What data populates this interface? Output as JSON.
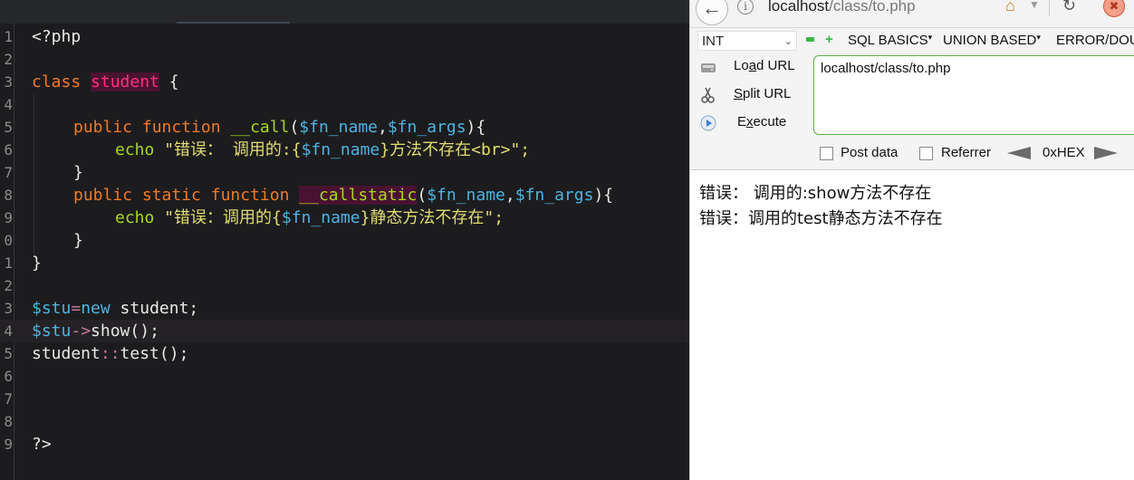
{
  "editor": {
    "line_numbers": [
      "1",
      "2",
      "3",
      "4",
      "5",
      "6",
      "7",
      "8",
      "9",
      "0",
      "1",
      "2",
      "3",
      "4",
      "5",
      "6",
      "7",
      "8",
      "9"
    ],
    "tokens": {
      "php_open": "<?php",
      "kw_class": "class",
      "class_name": "student",
      "brace_open": " {",
      "kw_public": "public",
      "kw_function": "function",
      "call_name": "__call",
      "paren_open": "(",
      "var_fn_name": "$fn_name",
      "comma": ",",
      "var_fn_args": "$fn_args",
      "paren_close_brace": "){",
      "kw_echo": "echo",
      "str1_a": "\"错误： 调用的:{",
      "str1_b": "}方法不存在",
      "str1_br": "<br>",
      "str1_end": "\";",
      "close_brace": "}",
      "kw_static": "static",
      "callstatic_name": "__callstatic",
      "str2_a": "\"错误：调用的{",
      "str2_b": "}静态方法不存在\";",
      "var_stu": "$stu",
      "op_assign": "=",
      "kw_new": "new",
      "new_rest": " student;",
      "op_arrow": "->",
      "show_call": "show();",
      "student_ref": "student",
      "op_scope": "::",
      "test_call": "test();",
      "php_close": "?>"
    }
  },
  "browser": {
    "url_bar": {
      "host": "localhost",
      "path": "/class/to.php"
    },
    "hackbar": {
      "int_select": "INT",
      "menus": [
        "SQL BASICS",
        "UNION BASED",
        "ERROR/DOU"
      ],
      "load_url_pre": "Lo",
      "load_url_u": "a",
      "load_url_post": "d URL",
      "split_url_u": "S",
      "split_url_post": "plit URL",
      "execute_pre": "E",
      "execute_u": "x",
      "execute_post": "ecute",
      "url_value": "localhost/class/to.php",
      "post_data_label": "Post data",
      "referrer_label": "Referrer",
      "hex_label": "0xHEX"
    },
    "page_output": [
      "错误： 调用的:show方法不存在",
      "错误：调用的test静态方法不存在"
    ]
  }
}
